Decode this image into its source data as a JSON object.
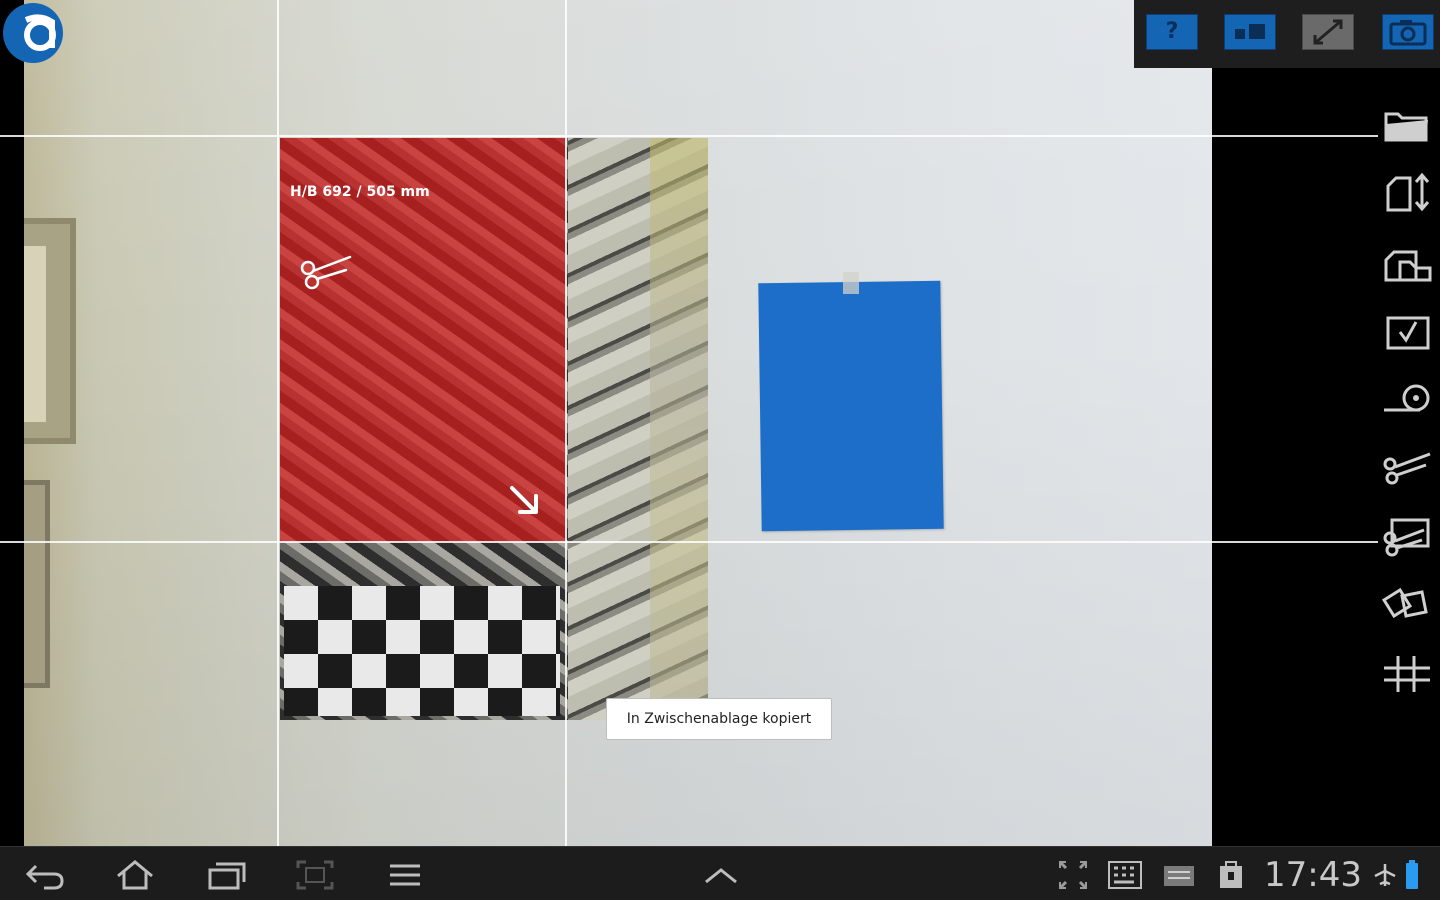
{
  "overlay": {
    "dimension_label": "H/B 692 / 505 mm"
  },
  "toast": {
    "message": "In Zwischenablage kopiert"
  },
  "toolbar": {
    "help_label": "?",
    "buttons": [
      "help-icon",
      "layout-icon",
      "expand-icon",
      "camera-icon"
    ]
  },
  "sidebar": {
    "icons": [
      "folder-icon",
      "page-orientation-icon",
      "page-stack-icon",
      "checkbox-icon",
      "tape-measure-icon",
      "scissors-icon",
      "cut-edit-icon",
      "rotate-pages-icon",
      "grid-icon"
    ]
  },
  "status_bar": {
    "time": "17:43",
    "icons": [
      "back-icon",
      "home-icon",
      "recent-apps-icon",
      "screenshot-icon",
      "menu-icon",
      "chevron-up-icon",
      "fullscreen-icon",
      "keyboard-icon",
      "usb-debug-icon",
      "clipboard-icon",
      "airplane-mode-icon",
      "battery-icon"
    ]
  },
  "colors": {
    "overlay_red": "#d61c1c",
    "accent_blue": "#1565b5",
    "paper_blue": "#1d6ec9"
  }
}
